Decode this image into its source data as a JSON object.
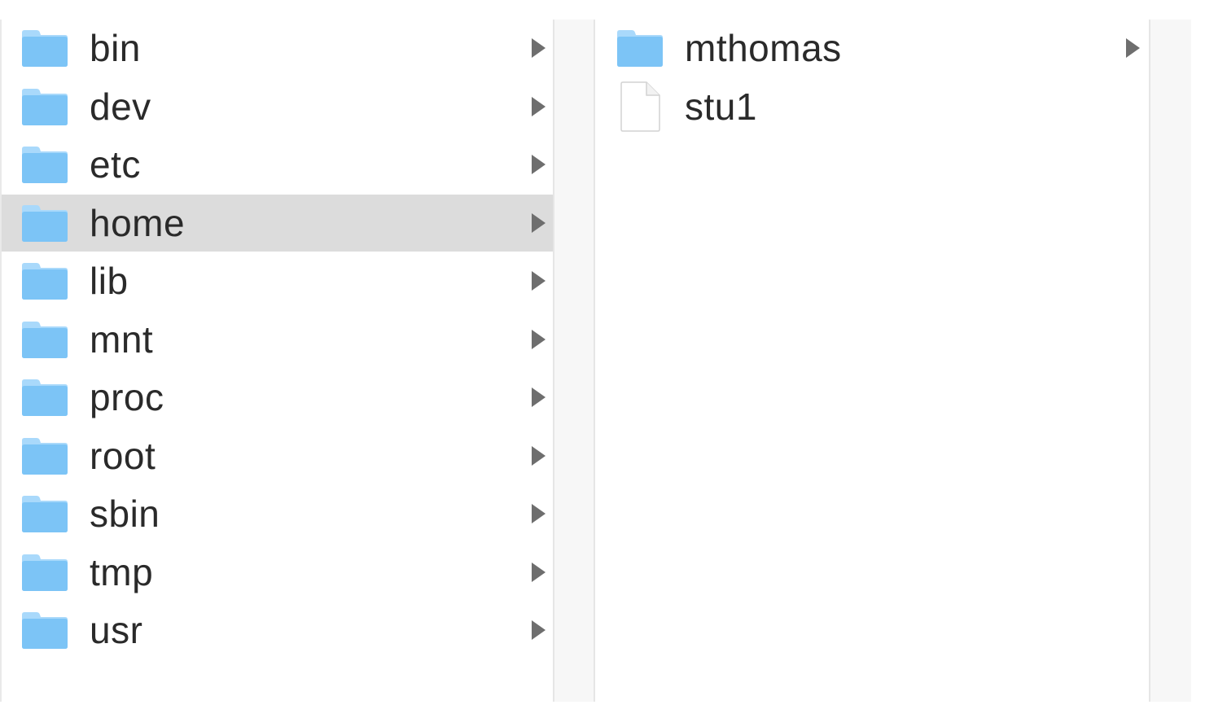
{
  "colors": {
    "folder_body": "#7cc4f6",
    "folder_tab": "#a9d9fb",
    "selection": "#dcdcdc",
    "chevron": "#6e6e6e",
    "text": "#2a2a2a"
  },
  "columns": [
    {
      "items": [
        {
          "label": "bin",
          "icon": "folder-icon",
          "has_children": true,
          "selected": false
        },
        {
          "label": "dev",
          "icon": "folder-icon",
          "has_children": true,
          "selected": false
        },
        {
          "label": "etc",
          "icon": "folder-icon",
          "has_children": true,
          "selected": false
        },
        {
          "label": "home",
          "icon": "folder-icon",
          "has_children": true,
          "selected": true
        },
        {
          "label": "lib",
          "icon": "folder-icon",
          "has_children": true,
          "selected": false
        },
        {
          "label": "mnt",
          "icon": "folder-icon",
          "has_children": true,
          "selected": false
        },
        {
          "label": "proc",
          "icon": "folder-icon",
          "has_children": true,
          "selected": false
        },
        {
          "label": "root",
          "icon": "folder-icon",
          "has_children": true,
          "selected": false
        },
        {
          "label": "sbin",
          "icon": "folder-icon",
          "has_children": true,
          "selected": false
        },
        {
          "label": "tmp",
          "icon": "folder-icon",
          "has_children": true,
          "selected": false
        },
        {
          "label": "usr",
          "icon": "folder-icon",
          "has_children": true,
          "selected": false
        }
      ]
    },
    {
      "items": [
        {
          "label": "mthomas",
          "icon": "folder-icon",
          "has_children": true,
          "selected": false
        },
        {
          "label": "stu1",
          "icon": "file-icon",
          "has_children": false,
          "selected": false
        }
      ]
    }
  ]
}
